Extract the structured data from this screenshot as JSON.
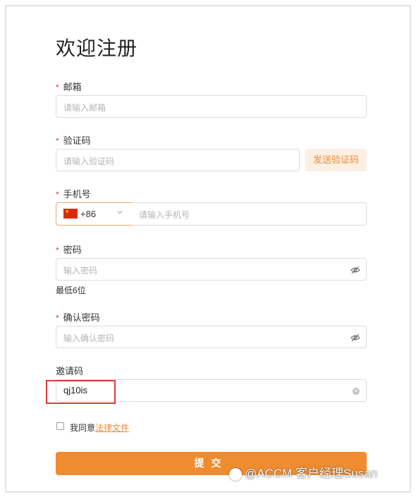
{
  "page": {
    "title": "欢迎注册"
  },
  "fields": {
    "email": {
      "label": "邮箱",
      "placeholder": "请输入邮箱"
    },
    "code": {
      "label": "验证码",
      "placeholder": "请输入验证码",
      "send_button": "发送验证码"
    },
    "phone": {
      "label": "手机号",
      "country_code": "+86",
      "country_flag": "cn-flag-icon",
      "placeholder": "请输入手机号"
    },
    "password": {
      "label": "密码",
      "placeholder": "输入密码",
      "hint": "最低6位"
    },
    "confirm_password": {
      "label": "确认密码",
      "placeholder": "输入确认密码"
    },
    "invite": {
      "label": "邀请码",
      "value": "qj10is"
    }
  },
  "agreement": {
    "text": "我同意",
    "link": "法律文件"
  },
  "submit": {
    "label": "提交"
  },
  "watermark": {
    "text": "@ACCM 客户经理Susan"
  },
  "colors": {
    "accent": "#ef8c2f",
    "required": "#e03a3a",
    "highlight_box": "#e03a3a"
  }
}
